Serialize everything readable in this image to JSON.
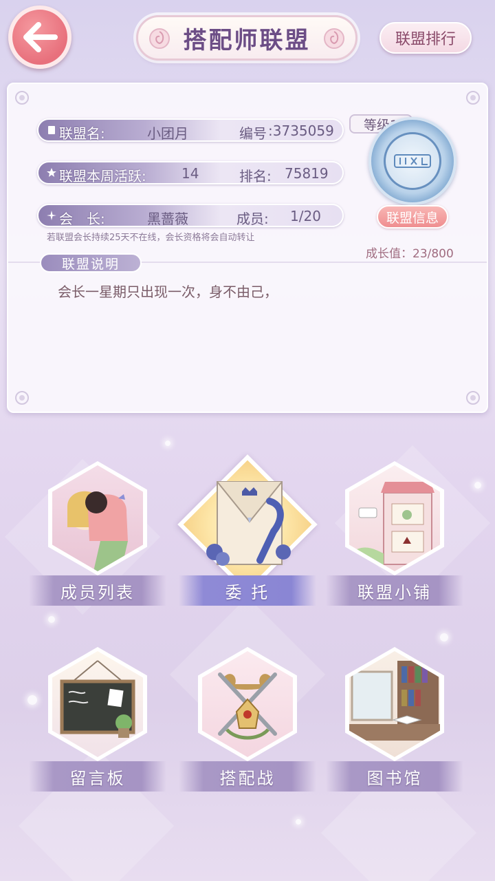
{
  "header": {
    "title": "搭配师联盟",
    "rank_button": "联盟排行"
  },
  "alliance": {
    "name_label": "联盟名:",
    "name_value": "小团月",
    "id_label": "编号",
    "id_value": ":3735059",
    "activity_label": "联盟本周活跃:",
    "activity_value": "14",
    "ranking_label": "排名:",
    "ranking_value": "75819",
    "leader_label": "会　长:",
    "leader_value": "黑蔷薇",
    "members_label": "成员:",
    "members_value": "1/20",
    "notice": "若联盟会长持续25天不在线，会长资格将会自动转让",
    "level": "等级1",
    "info_button": "联盟信息",
    "growth_label": "成长值：",
    "growth_value": "23/800",
    "description_tag": "联盟说明",
    "description": "会长一星期只出现一次，身不由己，"
  },
  "features": [
    {
      "label": "成员列表",
      "icon": "members-icon"
    },
    {
      "label": "委 托",
      "icon": "commission-letter-icon"
    },
    {
      "label": "联盟小铺",
      "icon": "shop-icon"
    },
    {
      "label": "留言板",
      "icon": "blackboard-icon"
    },
    {
      "label": "搭配战",
      "icon": "crossed-swords-icon"
    },
    {
      "label": "图书馆",
      "icon": "library-icon"
    }
  ],
  "colors": {
    "accent": "#6c4d86",
    "back_button": "#e8707c",
    "info_button": "#ef8e90",
    "label_band": "#a694c4"
  }
}
